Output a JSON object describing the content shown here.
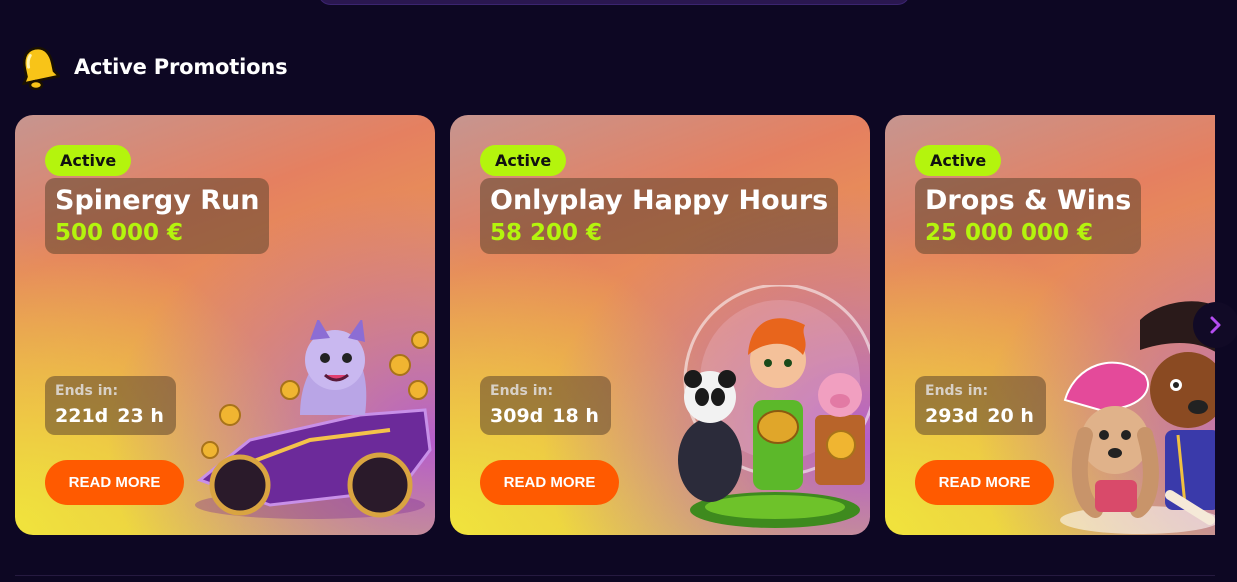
{
  "section": {
    "title": "Active Promotions",
    "icon": "bell-icon"
  },
  "promotions": [
    {
      "status": "Active",
      "name": "Spinergy Run",
      "amount": "500 000 €",
      "ends_label": "Ends in:",
      "days": "221d",
      "hours": "23 h",
      "button": "READ MORE",
      "art": "racing-fox-icon"
    },
    {
      "status": "Active",
      "name": "Onlyplay Happy Hours",
      "amount": "58 200 €",
      "ends_label": "Ends in:",
      "days": "309d",
      "hours": "18 h",
      "button": "READ MORE",
      "art": "leprechaun-panda-icon"
    },
    {
      "status": "Active",
      "name": "Drops & Wins",
      "amount": "25 000 000 €",
      "ends_label": "Ends in:",
      "days": "293d",
      "hours": "20 h",
      "button": "READ MORE",
      "art": "pirate-dogs-icon"
    }
  ],
  "carousel": {
    "next_icon": "chevron-right-icon"
  },
  "colors": {
    "background": "#0d0723",
    "badge": "#b4f40d",
    "amount": "#b4f40d",
    "button": "#ff5a00",
    "arrow": "#b44df0"
  }
}
